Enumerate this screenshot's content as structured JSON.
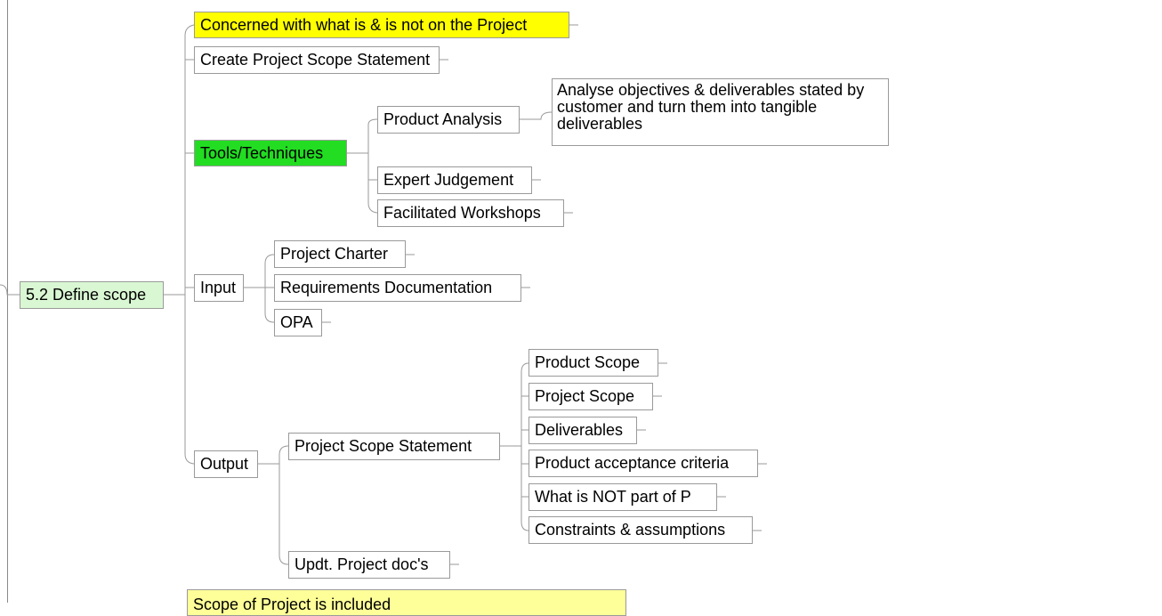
{
  "colors": {
    "root_fill": "#d9f7d3",
    "note_yellow": "#ffff00",
    "note_light_yellow": "#ffff99",
    "highlight_green": "#22dd22",
    "connector": "#9a9a9a"
  },
  "mindmap": {
    "root": "5.2 Define scope",
    "note_top": "Concerned with what is & is not on the Project",
    "create_statement": "Create Project Scope Statement",
    "tools": {
      "label": "Tools/Techniques",
      "product_analysis": "Product Analysis",
      "product_analysis_note": "Analyse objectives & deliverables stated by customer and turn them into tangible deliverables",
      "expert_judgement": "Expert Judgement",
      "facilitated_workshops": "Facilitated Workshops"
    },
    "input": {
      "label": "Input",
      "items": [
        "Project Charter",
        "Requirements Documentation",
        "OPA"
      ]
    },
    "output": {
      "label": "Output",
      "statement": "Project Scope Statement",
      "statement_items": [
        "Product Scope",
        "Project Scope",
        "Deliverables",
        "Product acceptance criteria",
        "What is NOT part of P",
        "Constraints & assumptions"
      ],
      "updates": "Updt. Project doc's"
    },
    "note_bottom": "Scope of Project is included"
  }
}
